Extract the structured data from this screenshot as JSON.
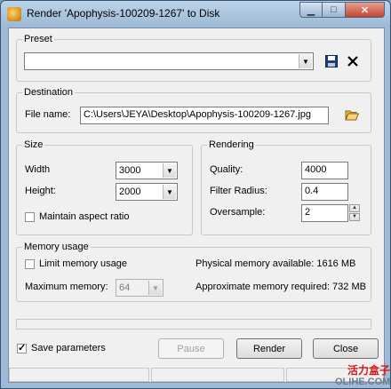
{
  "window": {
    "title": "Render 'Apophysis-100209-1267' to Disk",
    "minimize_glyph": "▁",
    "maximize_glyph": "□",
    "close_glyph": "✕"
  },
  "preset": {
    "legend": "Preset",
    "value": "",
    "save_icon": "floppy-disk-icon",
    "delete_icon": "x-icon"
  },
  "destination": {
    "legend": "Destination",
    "file_label": "File name:",
    "file_value": "C:\\Users\\JEYA\\Desktop\\Apophysis-100209-1267.jpg",
    "browse_icon": "open-folder-icon"
  },
  "size": {
    "legend": "Size",
    "width_label": "Width",
    "width_value": "3000",
    "height_label": "Height:",
    "height_value": "2000",
    "aspect_label": "Maintain aspect ratio",
    "aspect_checked": false
  },
  "rendering": {
    "legend": "Rendering",
    "quality_label": "Quality:",
    "quality_value": "4000",
    "filter_label": "Filter Radius:",
    "filter_value": "0.4",
    "oversample_label": "Oversample:",
    "oversample_value": "2"
  },
  "memory": {
    "legend": "Memory usage",
    "limit_label": "Limit memory usage",
    "limit_checked": false,
    "max_label": "Maximum memory:",
    "max_value": "64",
    "physical": "Physical memory available: 1616 MB",
    "required": "Approximate memory required: 732 MB"
  },
  "footer": {
    "save_params_label": "Save parameters",
    "save_params_checked": true,
    "pause": "Pause",
    "render": "Render",
    "close": "Close"
  },
  "watermark": {
    "line1": "活力盒子",
    "line2": "OLIHE.COM"
  },
  "colors": {
    "title_bar": "#9fbad6",
    "client": "#f0f0f0",
    "close_button": "#c4432c",
    "watermark_red": "#d01a1a"
  }
}
